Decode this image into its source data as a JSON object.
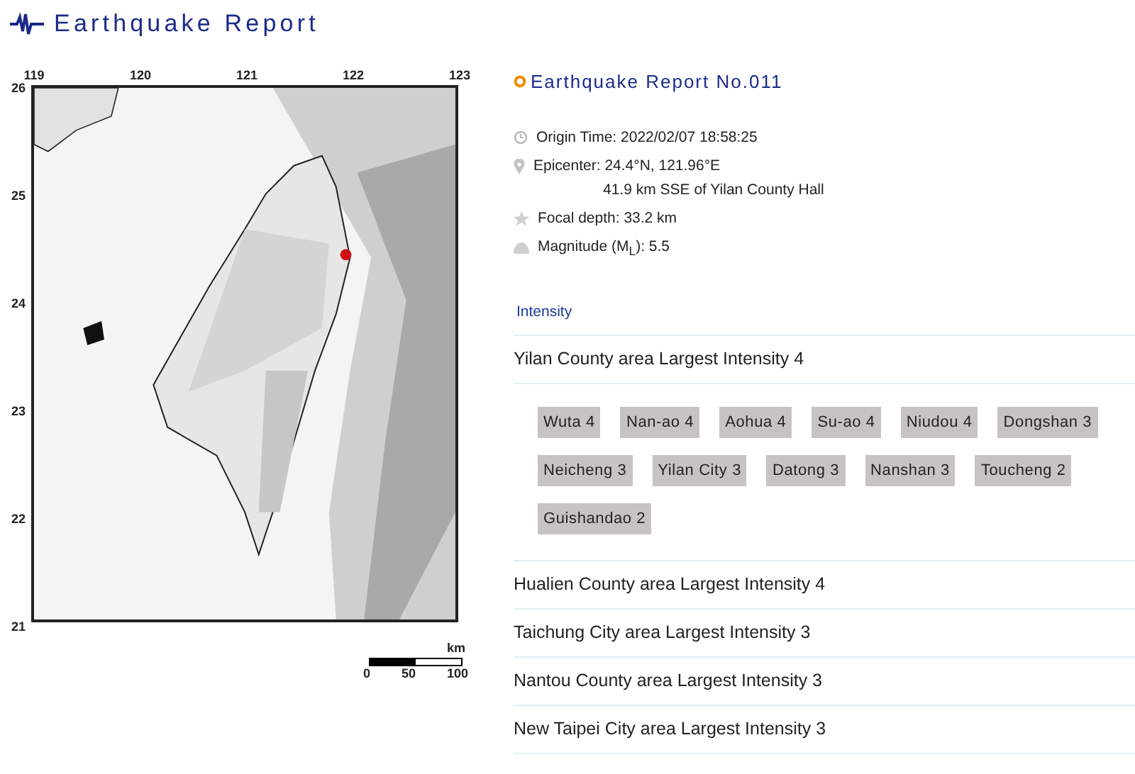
{
  "header": {
    "title": "Earthquake Report"
  },
  "map": {
    "lon_ticks": [
      "119",
      "120",
      "121",
      "122",
      "123"
    ],
    "lat_ticks": [
      "26",
      "25",
      "24",
      "23",
      "22",
      "21"
    ],
    "scale_unit": "km",
    "scale_labels": [
      "0",
      "50",
      "100"
    ]
  },
  "report": {
    "title": "Earthquake Report No.011",
    "details": [
      {
        "kind": "clock",
        "text": "Origin Time: 2022/02/07 18:58:25"
      },
      {
        "kind": "pin",
        "text": "Epicenter: 24.4°N, 121.96°E",
        "subtext": "41.9 km SSE of Yilan County Hall"
      },
      {
        "kind": "star",
        "text": "Focal depth: 33.2 km"
      },
      {
        "kind": "dome",
        "text": "Magnitude (M$_{L}$): 5.5"
      }
    ],
    "intensity_heading": "Intensity",
    "areas": [
      {
        "label": "Yilan County area Largest Intensity 4",
        "stations": [
          "Wuta 4",
          "Nan-ao 4",
          "Aohua 4",
          "Su-ao 4",
          "Niudou 4",
          "Dongshan 3",
          "Neicheng 3",
          "Yilan City 3",
          "Datong 3",
          "Nanshan 3",
          "Toucheng 2",
          "Guishandao 2"
        ]
      },
      {
        "label": "Hualien County area Largest Intensity 4"
      },
      {
        "label": "Taichung City area Largest Intensity 3"
      },
      {
        "label": "Nantou County area Largest Intensity 3"
      },
      {
        "label": "New Taipei City area Largest Intensity 3"
      }
    ]
  }
}
